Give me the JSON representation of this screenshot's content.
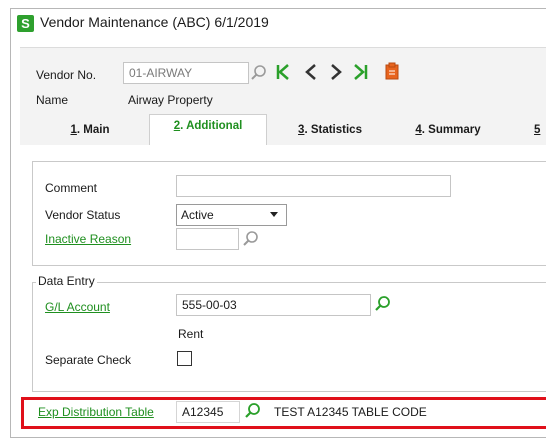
{
  "window": {
    "app_icon_letter": "S",
    "title": "Vendor Maintenance (ABC) 6/1/2019"
  },
  "header": {
    "vendor_no_label": "Vendor No.",
    "vendor_no_value": "01-AIRWAY",
    "name_label": "Name",
    "name_value": "Airway Property"
  },
  "nav": {
    "first": "K",
    "prev": "<",
    "next": ">",
    "last": ">I"
  },
  "tabs": [
    {
      "num": "1",
      "label": ". Main"
    },
    {
      "num": "2",
      "label": ". Additional"
    },
    {
      "num": "3",
      "label": ". Statistics"
    },
    {
      "num": "4",
      "label": ". Summary"
    },
    {
      "num": "5",
      "label": ""
    }
  ],
  "general": {
    "comment_label": "Comment",
    "comment_value": "",
    "vendor_status_label": "Vendor Status",
    "vendor_status_value": "Active",
    "inactive_reason_label": "Inactive Reason",
    "inactive_reason_value": ""
  },
  "data_entry": {
    "legend": "Data Entry",
    "gl_account_label": "G/L Account",
    "gl_account_value": "555-00-03",
    "gl_account_desc": "Rent",
    "separate_check_label": "Separate Check",
    "separate_check_checked": false
  },
  "exp_distribution": {
    "label": "Exp Distribution Table",
    "value": "A12345",
    "description": "TEST A12345 TABLE CODE"
  },
  "colors": {
    "accent_green": "#1f8f1f",
    "highlight_red": "#e0101a",
    "icon_orange": "#e8641e"
  },
  "icons": [
    "app-icon",
    "lookup-icon",
    "first-record-icon",
    "prev-record-icon",
    "next-record-icon",
    "last-record-icon",
    "memo-icon",
    "dropdown-arrow-icon"
  ]
}
